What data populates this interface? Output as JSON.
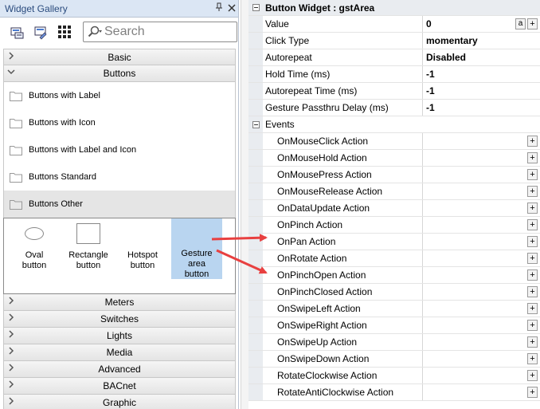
{
  "gallery": {
    "title": "Widget Gallery",
    "pin_icon": "pin-icon",
    "close_icon": "close-icon",
    "search_placeholder": "Search",
    "categories_top": [
      {
        "label": "Basic",
        "expanded": false
      },
      {
        "label": "Buttons",
        "expanded": true
      }
    ],
    "button_groups": [
      {
        "label": "Buttons with Label",
        "selected": false
      },
      {
        "label": "Buttons with Icon",
        "selected": false
      },
      {
        "label": "Buttons with Label and Icon",
        "selected": false
      },
      {
        "label": "Buttons Standard",
        "selected": false
      },
      {
        "label": "Buttons Other",
        "selected": true
      }
    ],
    "widgets": [
      {
        "label": "Oval\nbutton",
        "shape": "oval",
        "selected": false
      },
      {
        "label": "Rectangle\nbutton",
        "shape": "rect",
        "selected": false
      },
      {
        "label": "Hotspot\nbutton",
        "shape": "none",
        "selected": false
      },
      {
        "label": "Gesture\narea\nbutton",
        "shape": "none",
        "selected": true
      }
    ],
    "categories_bottom": [
      "Meters",
      "Switches",
      "Lights",
      "Media",
      "Advanced",
      "BACnet",
      "Graphic"
    ]
  },
  "props": {
    "header": "Button Widget : gstArea",
    "rows": [
      {
        "name": "Value",
        "value": "0",
        "has_a": true,
        "has_plus": true
      },
      {
        "name": "Click Type",
        "value": "momentary"
      },
      {
        "name": "Autorepeat",
        "value": "Disabled"
      },
      {
        "name": "Hold Time (ms)",
        "value": "-1"
      },
      {
        "name": "Autorepeat Time (ms)",
        "value": "-1"
      },
      {
        "name": "Gesture Passthru Delay (ms)",
        "value": "-1"
      }
    ],
    "events_label": "Events",
    "events": [
      "OnMouseClick Action",
      "OnMouseHold Action",
      "OnMousePress Action",
      "OnMouseRelease Action",
      "OnDataUpdate Action",
      "OnPinch Action",
      "OnPan Action",
      "OnRotate Action",
      "OnPinchOpen Action",
      "OnPinchClosed Action",
      "OnSwipeLeft Action",
      "OnSwipeRight Action",
      "OnSwipeUp Action",
      "OnSwipeDown Action",
      "RotateClockwise Action",
      "RotateAntiClockwise Action"
    ],
    "a_label": "a",
    "plus_label": "+"
  },
  "colors": {
    "highlight_orange": "#f7a04b",
    "highlight_yellow": "#fff66d",
    "arrow_red": "#e84040",
    "selection_blue": "#b9d5f0"
  }
}
